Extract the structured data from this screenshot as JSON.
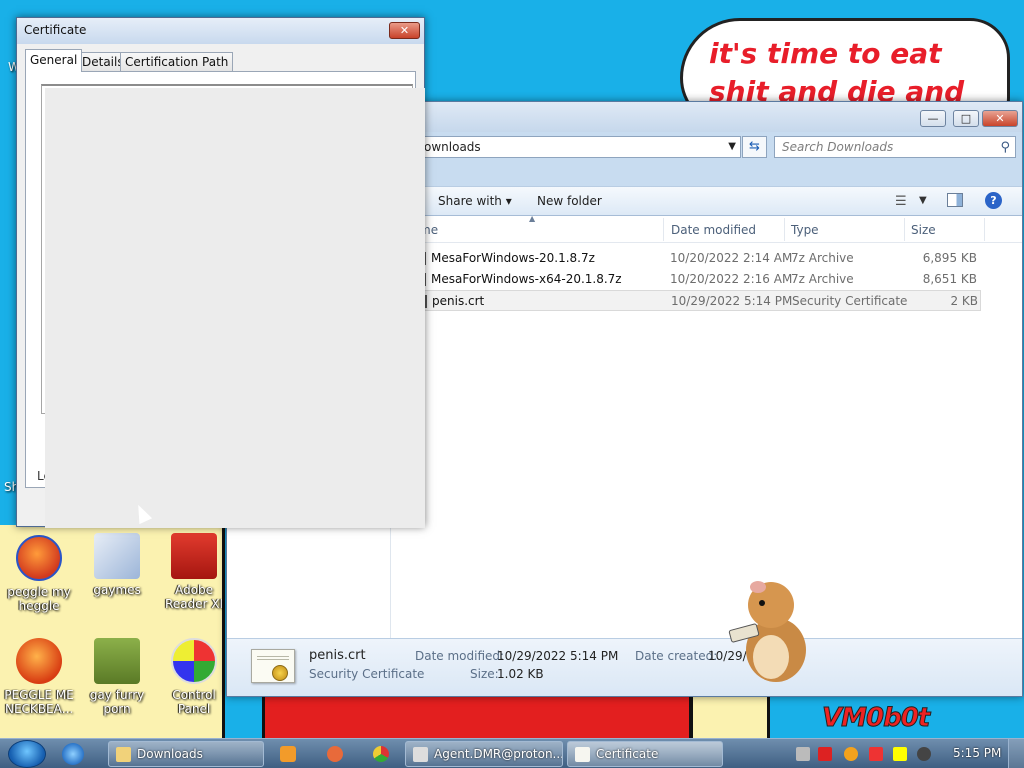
{
  "desktop": {
    "speech_text": "it's time to eat shit and die and chew",
    "watermark": "VM0b0t",
    "icons": [
      {
        "label": "peggle my heggle"
      },
      {
        "label": "gaymes"
      },
      {
        "label": "Adobe Reader XI"
      },
      {
        "label": "PEGGLE ME NECKBEA..."
      },
      {
        "label": "gay furry porn"
      },
      {
        "label": "Control Panel"
      }
    ],
    "edge_glyph_1": "W",
    "edge_glyph_2": "Sh"
  },
  "explorer": {
    "address": "ownloads",
    "search_placeholder": "Search Downloads",
    "toolbar": {
      "share_with": "Share with",
      "new_folder": "New folder"
    },
    "columns": [
      "me",
      "Date modified",
      "Type",
      "Size"
    ],
    "files": [
      {
        "name": "MesaForWindows-20.1.8.7z",
        "date": "10/20/2022 2:14 AM",
        "type": "7z Archive",
        "size": "6,895 KB"
      },
      {
        "name": "MesaForWindows-x64-20.1.8.7z",
        "date": "10/20/2022 2:16 AM",
        "type": "7z Archive",
        "size": "8,651 KB"
      },
      {
        "name": "penis.crt",
        "date": "10/29/2022 5:14 PM",
        "type": "Security Certificate",
        "size": "2 KB",
        "selected": true
      }
    ],
    "details": {
      "filename": "penis.crt",
      "filetype": "Security Certificate",
      "modified_label": "Date modified:",
      "modified_value": "10/29/2022 5:14 PM",
      "created_label": "Date created:",
      "created_value": "10/29/20",
      "size_label": "Size:",
      "size_value": "1.02 KB"
    }
  },
  "certificate": {
    "title": "Certificate",
    "tabs": [
      "General",
      "Details",
      "Certification Path"
    ],
    "active_tab": "General",
    "learn_stub": "Le"
  },
  "taskbar": {
    "tasks": [
      {
        "label": "Downloads"
      },
      {
        "label": "Agent.DMR@proton..."
      },
      {
        "label": "Certificate"
      }
    ],
    "clock": "5:15 PM"
  },
  "colors": {
    "accent": "#1a5cb4",
    "desktop": "#19b0e8",
    "speech_text": "#e81e2a"
  }
}
